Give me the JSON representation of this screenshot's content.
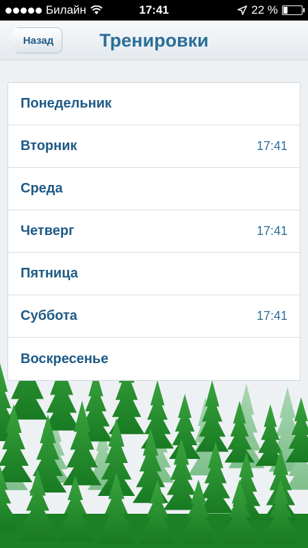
{
  "status_bar": {
    "carrier": "Билайн",
    "time": "17:41",
    "battery_percent": "22 %",
    "battery_level": 0.22
  },
  "nav": {
    "back_label": "Назад",
    "title": "Тренировки"
  },
  "days": [
    {
      "name": "Понедельник",
      "time": ""
    },
    {
      "name": "Вторник",
      "time": "17:41"
    },
    {
      "name": "Среда",
      "time": ""
    },
    {
      "name": "Четверг",
      "time": "17:41"
    },
    {
      "name": "Пятница",
      "time": ""
    },
    {
      "name": "Суббота",
      "time": "17:41"
    },
    {
      "name": "Воскресенье",
      "time": ""
    }
  ],
  "colors": {
    "accent": "#2a6f98",
    "forest_dark": "#1f8a2a",
    "forest_light": "#8fc9a0"
  }
}
